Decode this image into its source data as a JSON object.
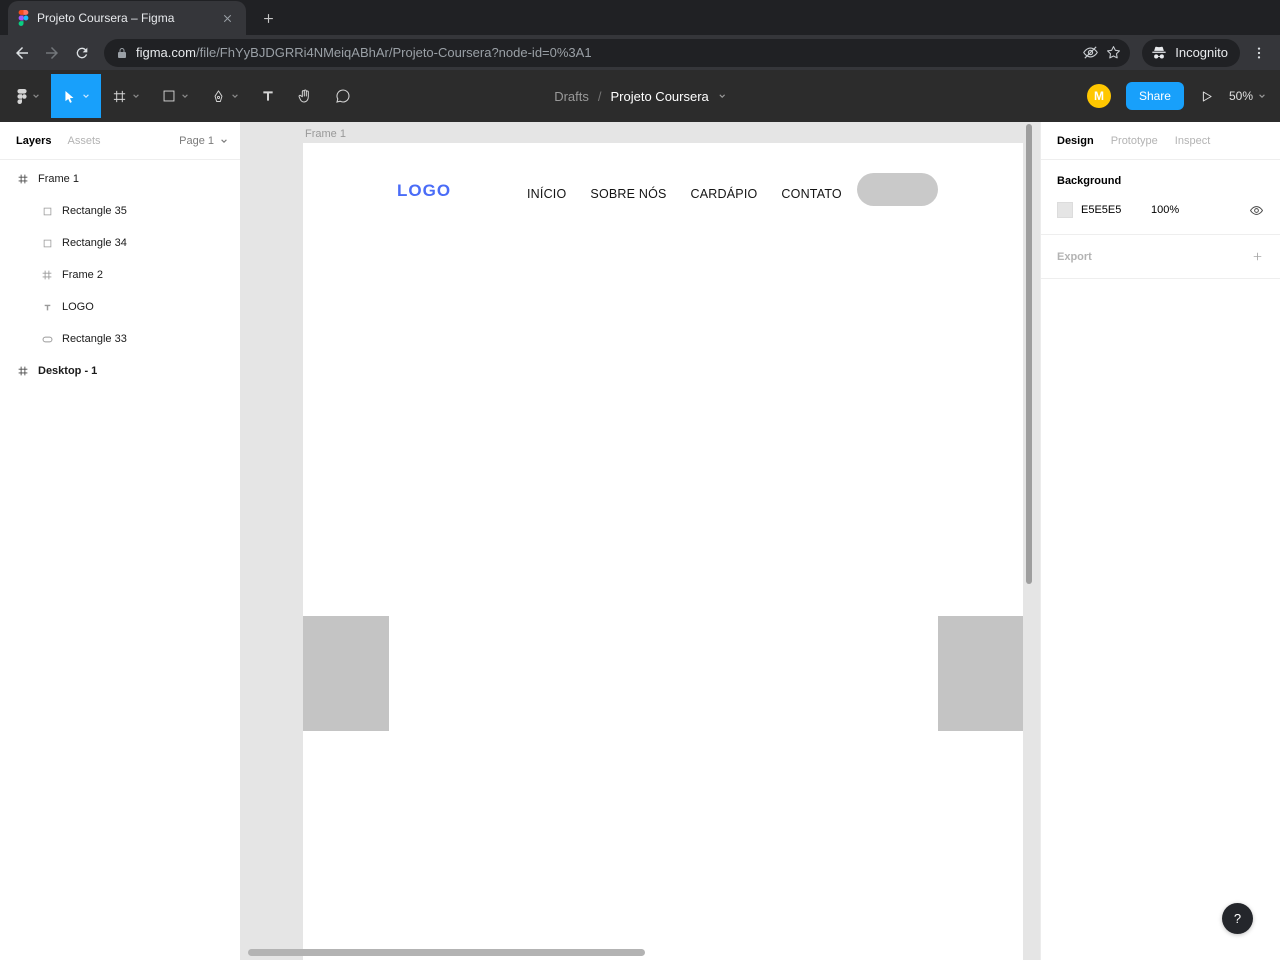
{
  "browser": {
    "tab_title": "Projeto Coursera – Figma",
    "url_domain": "figma.com",
    "url_path": "/file/FhYyBJDGRRi4NMeiqABhAr/Projeto-Coursera?node-id=0%3A1",
    "incognito_label": "Incognito"
  },
  "toolbar": {
    "breadcrumb": {
      "folder": "Drafts",
      "separator": "/",
      "title": "Projeto Coursera"
    },
    "avatar_initial": "M",
    "share_label": "Share",
    "zoom_level": "50%"
  },
  "layers_panel": {
    "tab_layers": "Layers",
    "tab_assets": "Assets",
    "page_label": "Page 1",
    "items": [
      {
        "label": "Frame 1"
      },
      {
        "label": "Rectangle 35"
      },
      {
        "label": "Rectangle 34"
      },
      {
        "label": "Frame 2"
      },
      {
        "label": "LOGO"
      },
      {
        "label": "Rectangle 33"
      },
      {
        "label": "Desktop - 1"
      }
    ]
  },
  "canvas": {
    "frame_label": "Frame 1",
    "design": {
      "logo": "LOGO",
      "nav": [
        "INÍCIO",
        "SOBRE NÓS",
        "CARDÁPIO",
        "CONTATO"
      ]
    }
  },
  "inspector": {
    "tab_design": "Design",
    "tab_prototype": "Prototype",
    "tab_inspect": "Inspect",
    "background_title": "Background",
    "background_hex": "E5E5E5",
    "background_opacity": "100%",
    "export_title": "Export",
    "help_label": "?"
  },
  "colors": {
    "figma_accent": "#18A0FB",
    "canvas_background": "#E5E5E5",
    "design_logo_blue": "#4A6CF7",
    "avatar_yellow": "#FFC700",
    "browser_dark": "#202124"
  }
}
